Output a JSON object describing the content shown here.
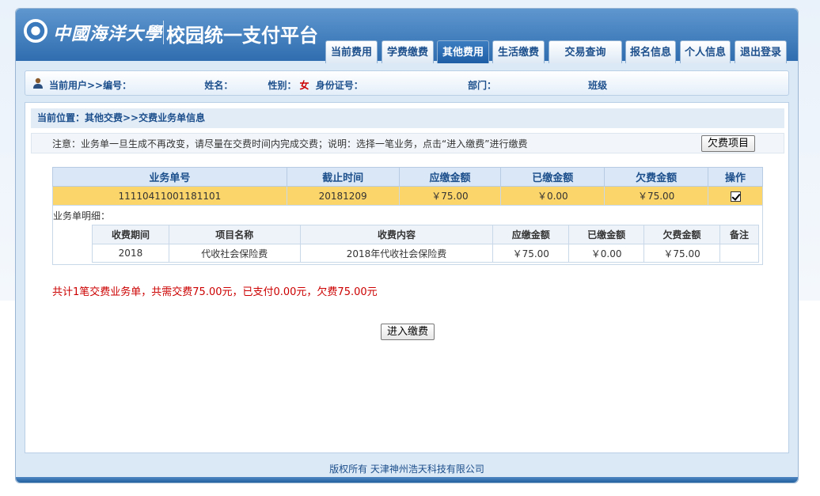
{
  "header": {
    "school_name": "中國海洋大學",
    "platform_title": "校园统一支付平台"
  },
  "nav": [
    {
      "label": "当前费用",
      "active": false
    },
    {
      "label": "学费缴费",
      "active": false
    },
    {
      "label": "其他费用",
      "active": true
    },
    {
      "label": "生活缴费",
      "active": false
    },
    {
      "label": "交易查询",
      "active": false
    },
    {
      "label": "报名信息",
      "active": false
    },
    {
      "label": "个人信息",
      "active": false
    },
    {
      "label": "退出登录",
      "active": false
    }
  ],
  "user": {
    "prefix": "当前用户>>编号：",
    "name_label": "姓名：",
    "gender_label": "性别：",
    "gender_value": "女",
    "id_label": "身份证号：",
    "dept_label": "部门：",
    "class_label": "班级"
  },
  "breadcrumb": "当前位置：其他交费>>交费业务单信息",
  "notice": "注意：业务单一旦生成不再改变，请尽量在交费时间内完成交费；说明：选择一笔业务，点击“进入缴费”进行缴费",
  "arrears_button": "欠费项目",
  "main_table": {
    "headers": [
      "业务单号",
      "截止时间",
      "应缴金额",
      "已缴金额",
      "欠费金额",
      "操作"
    ],
    "row": [
      "11110411001181101",
      "20181209",
      "￥75.00",
      "￥0.00",
      "￥75.00"
    ]
  },
  "detail": {
    "label": "业务单明细：",
    "headers": [
      "收费期间",
      "项目名称",
      "收费内容",
      "应缴金额",
      "已缴金额",
      "欠费金额",
      "备注"
    ],
    "row": [
      "2018",
      "代收社会保险费",
      "2018年代收社会保险费",
      "￥75.00",
      "￥0.00",
      "￥75.00",
      ""
    ]
  },
  "summary": "共计1笔交费业务单，共需交费75.00元，已支付0.00元，欠费75.00元",
  "pay_button": "进入缴费",
  "footer": "版权所有 天津神州浩天科技有限公司",
  "colors": {
    "brand_blue": "#2f6db0",
    "highlight_row": "#fbd46a",
    "alert_red": "#cc0000"
  }
}
